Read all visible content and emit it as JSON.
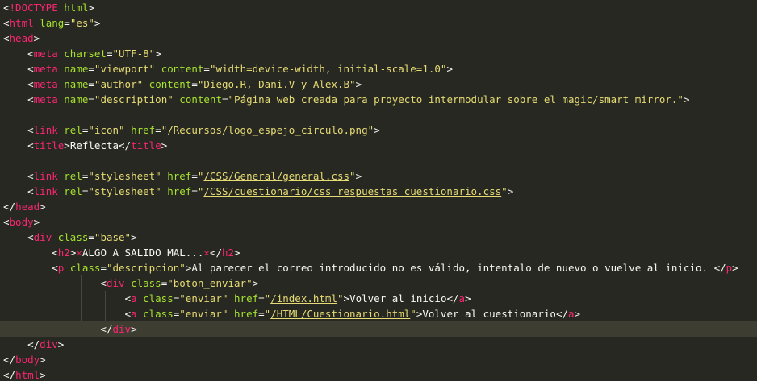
{
  "editor": {
    "theme": "monokai",
    "colors": {
      "background": "#272822",
      "tag": "#f92672",
      "attribute": "#a6e22e",
      "string": "#e6db74",
      "punctuation": "#f8f8f2",
      "current_line": "#3e3d32"
    },
    "current_line_index": 21,
    "lines": [
      [
        [
          "p",
          "<"
        ],
        [
          "t",
          "!DOCTYPE"
        ],
        [
          "p",
          " "
        ],
        [
          "a",
          "html"
        ],
        [
          "p",
          ">"
        ]
      ],
      [
        [
          "p",
          "<"
        ],
        [
          "t",
          "html"
        ],
        [
          "p",
          " "
        ],
        [
          "a",
          "lang"
        ],
        [
          "p",
          "="
        ],
        [
          "s",
          "\"es\""
        ],
        [
          "p",
          ">"
        ]
      ],
      [
        [
          "p",
          "<"
        ],
        [
          "t",
          "head"
        ],
        [
          "p",
          ">"
        ]
      ],
      [
        [
          "tx",
          "    "
        ],
        [
          "p",
          "<"
        ],
        [
          "t",
          "meta"
        ],
        [
          "p",
          " "
        ],
        [
          "a",
          "charset"
        ],
        [
          "p",
          "="
        ],
        [
          "s",
          "\"UTF-8\""
        ],
        [
          "p",
          ">"
        ]
      ],
      [
        [
          "tx",
          "    "
        ],
        [
          "p",
          "<"
        ],
        [
          "t",
          "meta"
        ],
        [
          "p",
          " "
        ],
        [
          "a",
          "name"
        ],
        [
          "p",
          "="
        ],
        [
          "s",
          "\"viewport\""
        ],
        [
          "p",
          " "
        ],
        [
          "a",
          "content"
        ],
        [
          "p",
          "="
        ],
        [
          "s",
          "\"width=device-width, initial-scale=1.0\""
        ],
        [
          "p",
          ">"
        ]
      ],
      [
        [
          "tx",
          "    "
        ],
        [
          "p",
          "<"
        ],
        [
          "t",
          "meta"
        ],
        [
          "p",
          " "
        ],
        [
          "a",
          "name"
        ],
        [
          "p",
          "="
        ],
        [
          "s",
          "\"author\""
        ],
        [
          "p",
          " "
        ],
        [
          "a",
          "content"
        ],
        [
          "p",
          "="
        ],
        [
          "s",
          "\"Diego.R, Dani.V y Alex.B\""
        ],
        [
          "p",
          ">"
        ]
      ],
      [
        [
          "tx",
          "    "
        ],
        [
          "p",
          "<"
        ],
        [
          "t",
          "meta"
        ],
        [
          "p",
          " "
        ],
        [
          "a",
          "name"
        ],
        [
          "p",
          "="
        ],
        [
          "s",
          "\"description\""
        ],
        [
          "p",
          " "
        ],
        [
          "a",
          "content"
        ],
        [
          "p",
          "="
        ],
        [
          "s",
          "\"Página web creada para proyecto intermodular sobre el magic/smart mirror.\""
        ],
        [
          "p",
          ">"
        ]
      ],
      [],
      [
        [
          "tx",
          "    "
        ],
        [
          "p",
          "<"
        ],
        [
          "t",
          "link"
        ],
        [
          "p",
          " "
        ],
        [
          "a",
          "rel"
        ],
        [
          "p",
          "="
        ],
        [
          "s",
          "\"icon\""
        ],
        [
          "p",
          " "
        ],
        [
          "a",
          "href"
        ],
        [
          "p",
          "="
        ],
        [
          "s",
          "\""
        ],
        [
          "u",
          "/Recursos/logo_espejo_circulo.png"
        ],
        [
          "s",
          "\""
        ],
        [
          "p",
          ">"
        ]
      ],
      [
        [
          "tx",
          "    "
        ],
        [
          "p",
          "<"
        ],
        [
          "t",
          "title"
        ],
        [
          "p",
          ">"
        ],
        [
          "tx",
          "Reflecta"
        ],
        [
          "p",
          "</"
        ],
        [
          "t",
          "title"
        ],
        [
          "p",
          ">"
        ]
      ],
      [],
      [
        [
          "tx",
          "    "
        ],
        [
          "p",
          "<"
        ],
        [
          "t",
          "link"
        ],
        [
          "p",
          " "
        ],
        [
          "a",
          "rel"
        ],
        [
          "p",
          "="
        ],
        [
          "s",
          "\"stylesheet\""
        ],
        [
          "p",
          " "
        ],
        [
          "a",
          "href"
        ],
        [
          "p",
          "="
        ],
        [
          "s",
          "\""
        ],
        [
          "u",
          "/CSS/General/general.css"
        ],
        [
          "s",
          "\""
        ],
        [
          "p",
          ">"
        ]
      ],
      [
        [
          "tx",
          "    "
        ],
        [
          "p",
          "<"
        ],
        [
          "t",
          "link"
        ],
        [
          "p",
          " "
        ],
        [
          "a",
          "rel"
        ],
        [
          "p",
          "="
        ],
        [
          "s",
          "\"stylesheet\""
        ],
        [
          "p",
          " "
        ],
        [
          "a",
          "href"
        ],
        [
          "p",
          "="
        ],
        [
          "s",
          "\""
        ],
        [
          "u",
          "/CSS/cuestionario/css_respuestas_cuestionario.css"
        ],
        [
          "s",
          "\""
        ],
        [
          "p",
          ">"
        ]
      ],
      [
        [
          "p",
          "</"
        ],
        [
          "t",
          "head"
        ],
        [
          "p",
          ">"
        ]
      ],
      [
        [
          "p",
          "<"
        ],
        [
          "t",
          "body"
        ],
        [
          "p",
          ">"
        ]
      ],
      [
        [
          "tx",
          "    "
        ],
        [
          "p",
          "<"
        ],
        [
          "t",
          "div"
        ],
        [
          "p",
          " "
        ],
        [
          "a",
          "class"
        ],
        [
          "p",
          "="
        ],
        [
          "s",
          "\"base\""
        ],
        [
          "p",
          ">"
        ]
      ],
      [
        [
          "tx",
          "        "
        ],
        [
          "p",
          "<"
        ],
        [
          "t",
          "h2"
        ],
        [
          "p",
          ">"
        ],
        [
          "x",
          "✕"
        ],
        [
          "tx",
          "ALGO A SALIDO MAL..."
        ],
        [
          "x",
          "✕"
        ],
        [
          "p",
          "</"
        ],
        [
          "t",
          "h2"
        ],
        [
          "p",
          ">"
        ]
      ],
      [
        [
          "tx",
          "        "
        ],
        [
          "p",
          "<"
        ],
        [
          "t",
          "p"
        ],
        [
          "p",
          " "
        ],
        [
          "a",
          "class"
        ],
        [
          "p",
          "="
        ],
        [
          "s",
          "\"descripcion\""
        ],
        [
          "p",
          ">"
        ],
        [
          "tx",
          "Al parecer el correo introducido no es válido, intentalo de nuevo o vuelve al inicio. "
        ],
        [
          "p",
          "</"
        ],
        [
          "t",
          "p"
        ],
        [
          "p",
          ">"
        ]
      ],
      [
        [
          "tx",
          "                "
        ],
        [
          "p",
          "<"
        ],
        [
          "t",
          "div"
        ],
        [
          "p",
          " "
        ],
        [
          "a",
          "class"
        ],
        [
          "p",
          "="
        ],
        [
          "s",
          "\"boton_enviar\""
        ],
        [
          "p",
          ">"
        ]
      ],
      [
        [
          "tx",
          "                    "
        ],
        [
          "p",
          "<"
        ],
        [
          "t",
          "a"
        ],
        [
          "p",
          " "
        ],
        [
          "a",
          "class"
        ],
        [
          "p",
          "="
        ],
        [
          "s",
          "\"enviar\""
        ],
        [
          "p",
          " "
        ],
        [
          "a",
          "href"
        ],
        [
          "p",
          "="
        ],
        [
          "s",
          "\""
        ],
        [
          "u",
          "/index.html"
        ],
        [
          "s",
          "\""
        ],
        [
          "p",
          ">"
        ],
        [
          "tx",
          "Volver al inicio"
        ],
        [
          "p",
          "</"
        ],
        [
          "t",
          "a"
        ],
        [
          "p",
          ">"
        ]
      ],
      [
        [
          "tx",
          "                    "
        ],
        [
          "p",
          "<"
        ],
        [
          "t",
          "a"
        ],
        [
          "p",
          " "
        ],
        [
          "a",
          "class"
        ],
        [
          "p",
          "="
        ],
        [
          "s",
          "\"enviar\""
        ],
        [
          "p",
          " "
        ],
        [
          "a",
          "href"
        ],
        [
          "p",
          "="
        ],
        [
          "s",
          "\""
        ],
        [
          "u",
          "/HTML/Cuestionario.html"
        ],
        [
          "s",
          "\""
        ],
        [
          "p",
          ">"
        ],
        [
          "tx",
          "Volver al cuestionario"
        ],
        [
          "p",
          "</"
        ],
        [
          "t",
          "a"
        ],
        [
          "p",
          ">"
        ]
      ],
      [
        [
          "tx",
          "                "
        ],
        [
          "p",
          "</"
        ],
        [
          "t",
          "div"
        ],
        [
          "p",
          ">"
        ]
      ],
      [
        [
          "tx",
          "    "
        ],
        [
          "p",
          "</"
        ],
        [
          "t",
          "div"
        ],
        [
          "p",
          ">"
        ]
      ],
      [
        [
          "p",
          "</"
        ],
        [
          "t",
          "body"
        ],
        [
          "p",
          ">"
        ]
      ],
      [
        [
          "p",
          "</"
        ],
        [
          "t",
          "html"
        ],
        [
          "p",
          ">"
        ]
      ]
    ]
  }
}
